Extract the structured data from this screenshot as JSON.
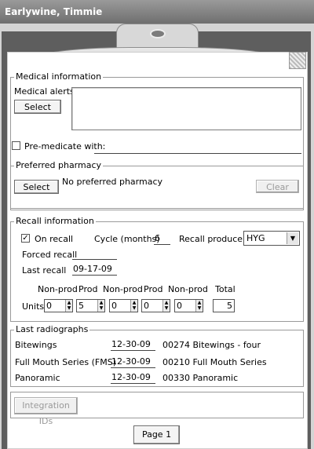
{
  "window": {
    "title": "Earlywine, Timmie"
  },
  "medical": {
    "legend": "Medical information",
    "alerts_label": "Medical alerts:",
    "select_label": "Select",
    "alerts_text": "",
    "premedicate_label": "Pre-medicate with:",
    "premedicate_value": "",
    "premedicate_checked": false
  },
  "pharmacy": {
    "legend": "Preferred pharmacy",
    "select_label": "Select",
    "value": "No preferred pharmacy",
    "clear_label": "Clear"
  },
  "recall": {
    "legend": "Recall information",
    "on_recall_label": "On recall",
    "on_recall_checked": true,
    "check_mark": "✓",
    "cycle_label": "Cycle (months)",
    "cycle_value": "6",
    "producer_label": "Recall producer",
    "producer_value": "HYG",
    "forced_label": "Forced recall",
    "forced_value": "",
    "last_label": "Last recall",
    "last_value": "09-17-09",
    "units_label": "Units",
    "columns": [
      "Non-prod",
      "Prod",
      "Non-prod",
      "Prod",
      "Non-prod",
      "Total"
    ],
    "units": [
      "0",
      "5",
      "0",
      "0",
      "0"
    ],
    "total": "5"
  },
  "radiographs": {
    "legend": "Last radiographs",
    "rows": [
      {
        "name": "Bitewings",
        "date": "12-30-09",
        "code": "00274 Bitewings - four"
      },
      {
        "name": "Full Mouth Series (FMS)",
        "date": "12-30-09",
        "code": "00210 Full Mouth Series"
      },
      {
        "name": "Panoramic",
        "date": "12-30-09",
        "code": "00330 Panoramic"
      }
    ]
  },
  "integration_label": "Integration IDs",
  "page_button_label": "Page 1"
}
